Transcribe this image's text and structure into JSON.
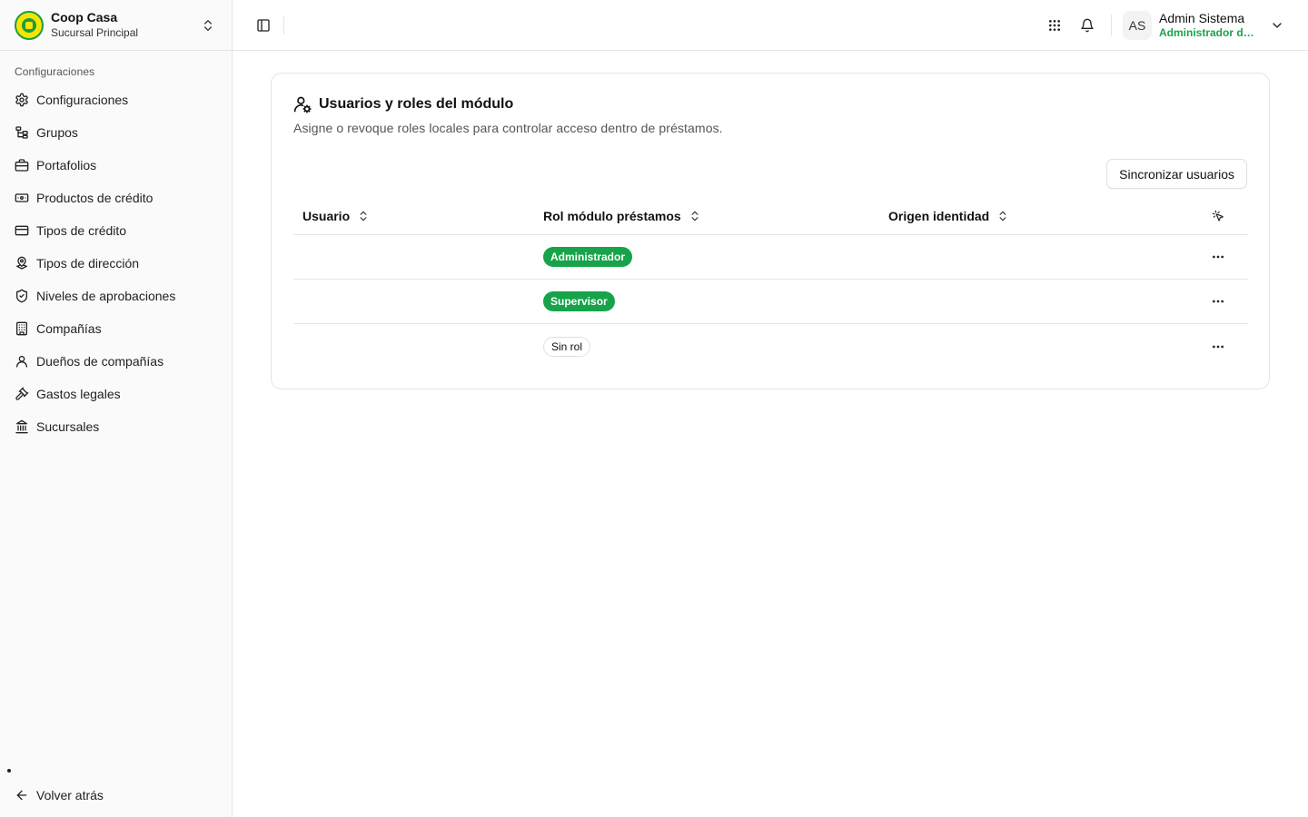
{
  "brand": {
    "name": "Coop Casa",
    "branch": "Sucursal Principal"
  },
  "sidebar": {
    "group_label": "Configuraciones",
    "items": [
      {
        "label": "Configuraciones",
        "icon": "gear-icon"
      },
      {
        "label": "Grupos",
        "icon": "tree-icon"
      },
      {
        "label": "Portafolios",
        "icon": "briefcase-icon"
      },
      {
        "label": "Productos de crédito",
        "icon": "banknote-icon"
      },
      {
        "label": "Tipos de crédito",
        "icon": "credit-card-icon"
      },
      {
        "label": "Tipos de dirección",
        "icon": "map-pin-icon"
      },
      {
        "label": "Niveles de aprobaciones",
        "icon": "shield-check-icon"
      },
      {
        "label": "Compañías",
        "icon": "building-icon"
      },
      {
        "label": "Dueños de compañías",
        "icon": "user-icon"
      },
      {
        "label": "Gastos legales",
        "icon": "gavel-icon"
      },
      {
        "label": "Sucursales",
        "icon": "landmark-icon"
      }
    ],
    "back_label": "Volver atrás"
  },
  "header": {
    "user": {
      "initials": "AS",
      "name": "Admin Sistema",
      "role": "Administrador del sistema"
    }
  },
  "card": {
    "title": "Usuarios y roles del módulo",
    "description": "Asigne o revoque roles locales para controlar acceso dentro de préstamos.",
    "sync_label": "Sincronizar usuarios"
  },
  "table": {
    "columns": [
      "Usuario",
      "Rol módulo préstamos",
      "Origen identidad"
    ],
    "rows": [
      {
        "user": "",
        "role": "Administrador",
        "origin": ""
      },
      {
        "user": "",
        "role": "Supervisor",
        "origin": ""
      },
      {
        "user": "",
        "role": "Sin rol",
        "origin": ""
      }
    ]
  },
  "colors": {
    "accent": "#17a34a",
    "brand_yellow": "#f7e500"
  }
}
